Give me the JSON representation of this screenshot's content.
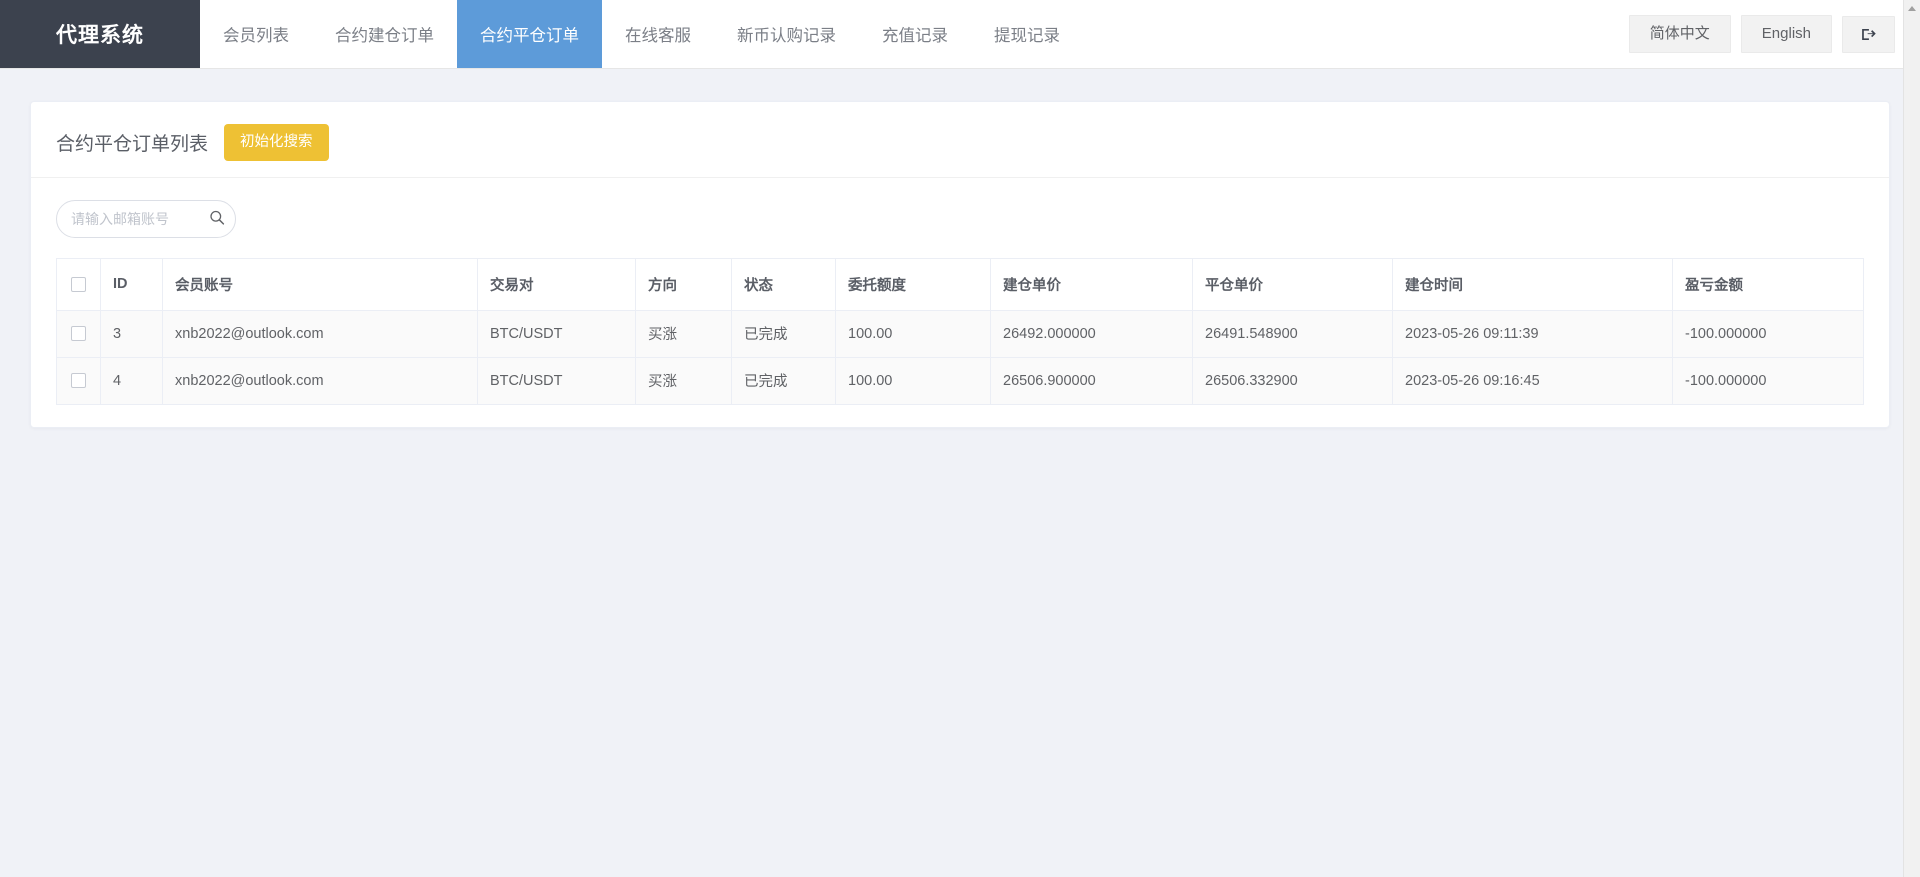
{
  "navbar": {
    "brand": "代理系统",
    "items": [
      {
        "label": "会员列表",
        "active": false
      },
      {
        "label": "合约建仓订单",
        "active": false
      },
      {
        "label": "合约平仓订单",
        "active": true
      },
      {
        "label": "在线客服",
        "active": false
      },
      {
        "label": "新币认购记录",
        "active": false
      },
      {
        "label": "充值记录",
        "active": false
      },
      {
        "label": "提现记录",
        "active": false
      }
    ],
    "lang_cn": "简体中文",
    "lang_en": "English",
    "logout_icon": "logout-icon"
  },
  "card": {
    "title": "合约平仓订单列表",
    "reset_search_label": "初始化搜索"
  },
  "search": {
    "value": "",
    "placeholder": "请输入邮箱账号",
    "icon": "search-icon"
  },
  "table": {
    "headers": {
      "select_all": "",
      "id": "ID",
      "account": "会员账号",
      "pair": "交易对",
      "direction": "方向",
      "status": "状态",
      "amount": "委托额度",
      "open_price": "建仓单价",
      "close_price": "平仓单价",
      "open_time": "建仓时间",
      "pnl": "盈亏金额"
    },
    "rows": [
      {
        "id": "3",
        "account": "xnb2022@outlook.com",
        "pair": "BTC/USDT",
        "direction": "买涨",
        "status": "已完成",
        "amount": "100.00",
        "open_price": "26492.000000",
        "close_price": "26491.548900",
        "open_time": "2023-05-26 09:11:39",
        "pnl": "-100.000000"
      },
      {
        "id": "4",
        "account": "xnb2022@outlook.com",
        "pair": "BTC/USDT",
        "direction": "买涨",
        "status": "已完成",
        "amount": "100.00",
        "open_price": "26506.900000",
        "close_price": "26506.332900",
        "open_time": "2023-05-26 09:16:45",
        "pnl": "-100.000000"
      }
    ]
  },
  "colors": {
    "brand_bg": "#3c424e",
    "active_tab": "#5d9bd9",
    "warning": "#eec134",
    "green": "#2ec98b",
    "red": "#f55f70",
    "page_bg": "#f0f2f7"
  }
}
